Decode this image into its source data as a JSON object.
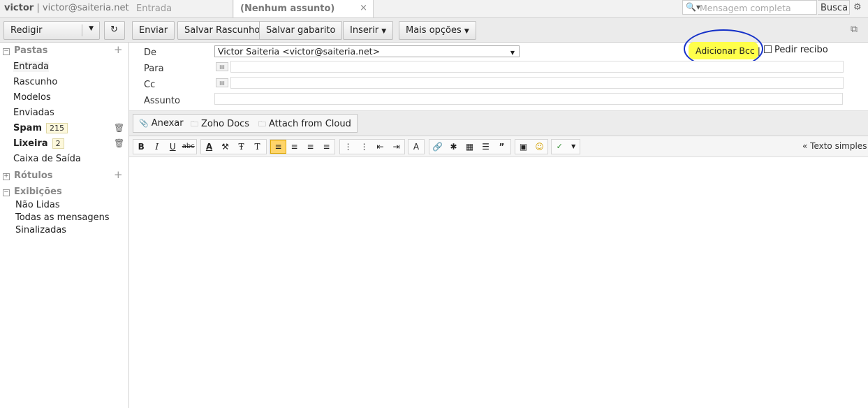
{
  "topbar": {
    "username": "victor",
    "separator": "|",
    "email": "victor@saiteria.net",
    "tabs": [
      {
        "label": "Entrada"
      },
      {
        "label": "(Nenhum assunto)",
        "close": "×"
      }
    ],
    "search_placeholder": "Mensagem completa",
    "search_button": "Busca"
  },
  "toolbar": {
    "compose_label": "Redigir",
    "send_label": "Enviar",
    "save_draft_label": "Salvar Rascunho",
    "save_template_label": "Salvar gabarito",
    "insert_label": "Inserir",
    "more_options_label": "Mais opções"
  },
  "sidebar": {
    "folders_title": "Pastas",
    "folders": [
      {
        "label": "Entrada"
      },
      {
        "label": "Rascunho"
      },
      {
        "label": "Modelos"
      },
      {
        "label": "Enviadas"
      },
      {
        "label": "Spam",
        "count": "215"
      },
      {
        "label": "Lixeira",
        "count": "2"
      },
      {
        "label": "Caixa de Saída"
      }
    ],
    "labels_title": "Rótulos",
    "views_title": "Exibições",
    "views": [
      {
        "label": "Não Lidas"
      },
      {
        "label": "Todas as mensagens"
      },
      {
        "label": "Sinalizadas"
      }
    ]
  },
  "compose": {
    "from_label": "De",
    "from_value": "Victor Saiteria <victor@saiteria.net>",
    "to_label": "Para",
    "cc_label": "Cc",
    "subject_label": "Assunto",
    "add_bcc": "Adicionar Bcc |",
    "request_receipt": "Pedir recibo"
  },
  "attach": {
    "attach_label": "Anexar",
    "zoho_docs_label": "Zoho Docs",
    "cloud_label": "Attach from Cloud"
  },
  "editor": {
    "plain_text_link": "« Texto simples"
  },
  "colors": {
    "highlight": "#ffff4a",
    "annotation_circle": "#1430c8"
  }
}
